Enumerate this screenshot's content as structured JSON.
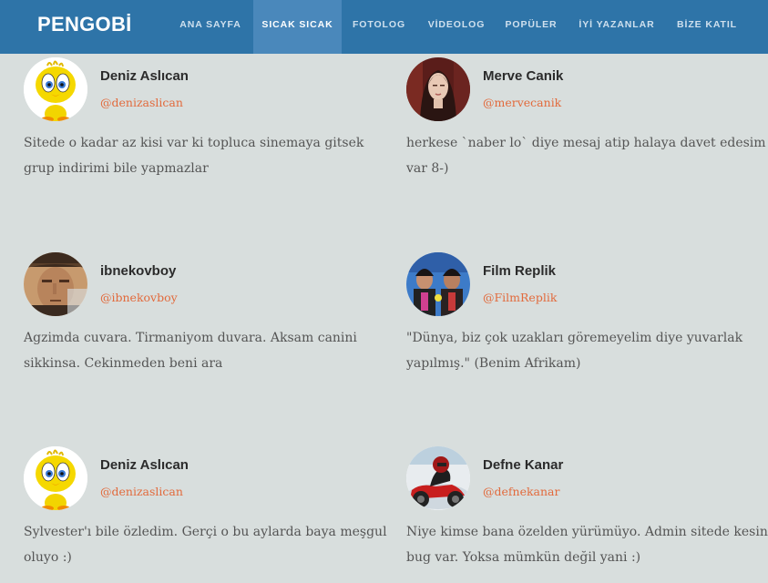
{
  "site": {
    "logo": "PENGOBİ"
  },
  "nav": {
    "items": [
      {
        "label": "ANA SAYFA"
      },
      {
        "label": "SICAK SICAK"
      },
      {
        "label": "FOTOLOG"
      },
      {
        "label": "VİDEOLOG"
      },
      {
        "label": "POPÜLER"
      },
      {
        "label": "İYİ YAZANLAR"
      },
      {
        "label": "BİZE KATIL"
      }
    ],
    "active": "SICAK SICAK"
  },
  "posts": [
    {
      "name": "Deniz Aslıcan",
      "handle": "@denizaslican",
      "text": "Sitede o kadar az kisi var ki topluca sinemaya gitsek grup indirimi bile yapmazlar",
      "avatar": "tweety-avatar-icon"
    },
    {
      "name": "Merve Canik",
      "handle": "@mervecanik",
      "text": "herkese `naber lo` diye mesaj atip halaya davet edesim var 8-)",
      "avatar": "woman-portrait-avatar-icon"
    },
    {
      "name": "ibnekovboy",
      "handle": "@ibnekovboy",
      "text": "Agzimda cuvara. Tirmaniyom duvara. Aksam canini sikkinsa. Cekinmeden beni ara",
      "avatar": "cowboy-portrait-avatar-icon"
    },
    {
      "name": "Film Replik",
      "handle": "@FilmReplik",
      "text": "\"Dünya, biz çok uzakları göremeyelim diye yuvarlak yapılmış.\" (Benim Afrikam)",
      "avatar": "film-still-avatar-icon"
    },
    {
      "name": "Deniz Aslıcan",
      "handle": "@denizaslican",
      "text": "Sylvester'ı bile özledim. Gerçi o bu aylarda baya meşgul oluyo :)",
      "avatar": "tweety-avatar-icon"
    },
    {
      "name": "Defne Kanar",
      "handle": "@defnekanar",
      "text": "Niye kimse bana özelden yürümüyo. Admin sitede kesin bug var. Yoksa mümkün değil yani :)",
      "avatar": "motorcycle-rider-avatar-icon"
    }
  ],
  "colors": {
    "navbar": "#2e74a8",
    "active_tab": "#4a88bb",
    "handle": "#e26a3c",
    "background": "#d8dedd"
  }
}
